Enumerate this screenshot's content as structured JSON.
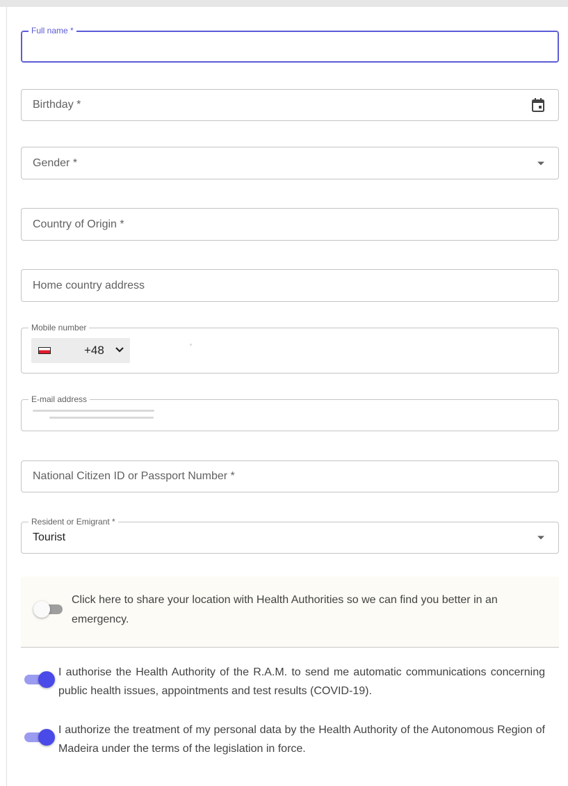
{
  "form": {
    "full_name": {
      "label": "Full name *",
      "value": ""
    },
    "birthday": {
      "placeholder": "Birthday *",
      "icon": "calendar-icon"
    },
    "gender": {
      "placeholder": "Gender *",
      "icon": "dropdown-caret-icon"
    },
    "country_of_origin": {
      "placeholder": "Country of Origin *"
    },
    "home_address": {
      "placeholder": "Home country address"
    },
    "mobile": {
      "label": "Mobile number",
      "flag": "poland-flag-icon",
      "dial_code": "+48",
      "chevron": "chevron-down-icon"
    },
    "email": {
      "label": "E-mail address"
    },
    "national_id": {
      "placeholder": "National Citizen ID or Passport Number *"
    },
    "resident": {
      "label": "Resident or Emigrant *",
      "value": "Tourist",
      "icon": "dropdown-caret-icon"
    }
  },
  "location": {
    "text": "Click here to share your location with Health Authorities so we can find you better in an emergency.",
    "enabled": false
  },
  "consents": [
    {
      "text": "I authorise the Health Authority of the R.A.M. to send me automatic communications concerning public health issues, appointments and test results (COVID-19).",
      "enabled": true
    },
    {
      "text": "I authorize the treatment of my personal data by the Health Authority of the Autonomous Region of Madeira under the terms of the legislation in force.",
      "enabled": true
    }
  ],
  "colors": {
    "accent": "#5b5bd6",
    "switch_on_thumb": "#4a4ae8",
    "switch_on_track": "#9b9bf0",
    "location_bg": "#fcfbf5"
  }
}
